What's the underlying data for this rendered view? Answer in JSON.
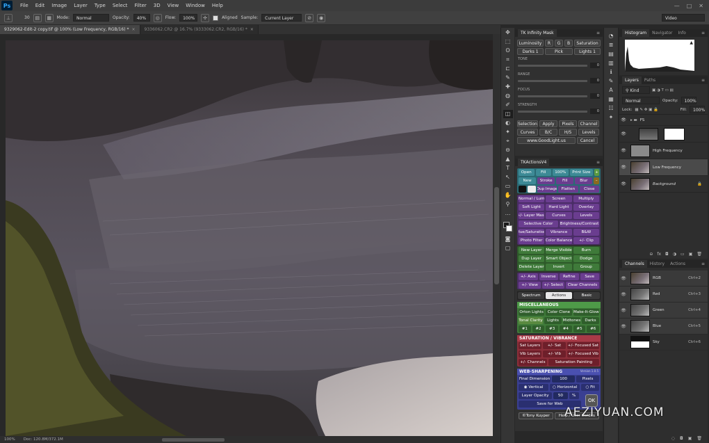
{
  "app": {
    "logo": "Ps"
  },
  "menu": [
    "File",
    "Edit",
    "Image",
    "Layer",
    "Type",
    "Select",
    "Filter",
    "3D",
    "View",
    "Window",
    "Help"
  ],
  "window_controls": [
    "—",
    "□",
    "✕"
  ],
  "options": {
    "size": "30",
    "mode_label": "Mode:",
    "mode_value": "Normal",
    "opacity_label": "Opacity:",
    "opacity_value": "40%",
    "flow_label": "Flow:",
    "flow_value": "100%",
    "aligned_label": "Aligned",
    "sample_label": "Sample:",
    "sample_value": "Current Layer",
    "workspace": "Video"
  },
  "tabs": [
    {
      "label": "9329062-Edit-2 copy.tif @ 100% (Low Frequency, RGB/16) *",
      "close": "×"
    },
    {
      "label": "9336062.CR2 @ 16.7% (9333062.CR2, RGB/16) *",
      "close": "×"
    }
  ],
  "status": {
    "zoom": "100%",
    "doc": "Doc: 120.8M/372.1M"
  },
  "tools": [
    "✥",
    "⬚",
    "ʘ",
    "⌗",
    "⊏",
    "✎",
    "✚",
    "◍",
    "✐",
    "◫",
    "◐",
    "✦",
    "⌖",
    "⊖",
    "▲",
    "T",
    "↖",
    "▭",
    "✋",
    "⚲",
    "…"
  ],
  "tk_mask": {
    "title": "TK Infinity Mask",
    "top_row": [
      "Luminosity",
      "R",
      "G",
      "B",
      "Saturation"
    ],
    "second_row": [
      "Darks 1",
      "Pick",
      "Lights 1"
    ],
    "sliders": [
      {
        "label": "TONE",
        "value": "0"
      },
      {
        "label": "RANGE",
        "value": "0"
      },
      {
        "label": "FOCUS",
        "value": "0"
      },
      {
        "label": "STRENGTH",
        "value": "0"
      }
    ],
    "row_a": [
      "Selection",
      "Apply",
      "Pixels",
      "Channel"
    ],
    "row_b": [
      "Curves",
      "B/C",
      "H/S",
      "Levels"
    ],
    "row_c": [
      "www.GoodLight.us",
      "Cancel"
    ]
  },
  "tk_actions": {
    "title": "TKActionsV4",
    "r1": [
      "Open",
      "Fill",
      "100%",
      "Print Size",
      "+"
    ],
    "r2": [
      "New",
      "Stroke",
      "Fill",
      "Blur",
      "–"
    ],
    "r3": [
      "Dup Image",
      "Flatten",
      "Close"
    ],
    "purple_rows": [
      [
        "Normal / Lum",
        "Screen",
        "Multiply"
      ],
      [
        "Soft Light",
        "Hard Light",
        "Overlay"
      ],
      [
        "+/- Layer Mask",
        "Curves",
        "Levels"
      ],
      [
        "Selective Color",
        "Brightness/Contrast"
      ],
      [
        "Hue/Saturation",
        "Vibrance",
        "B&W"
      ],
      [
        "Photo Filter",
        "Color Balance",
        "+/- Clip"
      ]
    ],
    "green_rows": [
      [
        "New Layer",
        "Merge Visible",
        "Burn"
      ],
      [
        "Dup Layer",
        "Smart Object",
        "Dodge"
      ],
      [
        "Delete Layer",
        "Invert",
        "Group"
      ]
    ],
    "purple_rows_2": [
      [
        "+/- Axis",
        "Inverse",
        "Refine",
        "Save"
      ],
      [
        "+/- View",
        "+/- Select",
        "Clear Channels"
      ]
    ],
    "tabs": [
      "Spectrum",
      "Actions",
      "Basic"
    ],
    "misc": {
      "title": "MISCELLANEOUS",
      "rows": [
        [
          "Orton Lights",
          "Color Clone",
          "Make-It-Glow"
        ],
        [
          "Tonal Clarity",
          "Lights",
          "Midtones",
          "Darks"
        ],
        [
          "#1",
          "#2",
          "#3",
          "#4",
          "#5",
          "#6"
        ]
      ]
    },
    "sat": {
      "title": "SATURATION / VIBRANCE",
      "rows": [
        [
          "Sat Layers",
          "+/- Sat",
          "+/- Focused Sat"
        ],
        [
          "Vib Layers",
          "+/- Vib",
          "+/- Focused Vib"
        ],
        [
          "+/- Channels",
          "Saturation Painting"
        ]
      ]
    },
    "web": {
      "title": "WEB-SHARPENING",
      "version": "Version 1.0.5",
      "final_dim_label": "Final Dimension",
      "final_dim_value": "100",
      "final_dim_unit": "Pixels",
      "orient": [
        "Vertical",
        "Horizontal",
        "Fit"
      ],
      "opacity_label": "Layer Opacity",
      "opacity_value": "50",
      "opacity_unit": "%",
      "save": "Save for Web",
      "ok": "OK"
    },
    "footer": [
      "©Tony Kuyper",
      "Help / User Guides"
    ]
  },
  "histogram": {
    "tabs": [
      "Histogram",
      "Navigator",
      "Info"
    ],
    "warning": "▲"
  },
  "layers": {
    "tabs": [
      "Layers",
      "Paths"
    ],
    "kind_label": "Kind",
    "blend": "Normal",
    "opacity_label": "Opacity:",
    "opacity_value": "100%",
    "lock_label": "Lock:",
    "fill_label": "Fill:",
    "fill_value": "100%",
    "items": [
      {
        "name": "FS",
        "type": "group"
      },
      {
        "name": "",
        "type": "white"
      },
      {
        "name": "High Frequency",
        "type": "gray"
      },
      {
        "name": "Low Frequency",
        "type": "photo",
        "selected": true
      },
      {
        "name": "Background",
        "type": "photo",
        "lock": "🔒"
      }
    ],
    "bottom_icons": [
      "⊖",
      "fx",
      "◘",
      "◑",
      "▭",
      "▣",
      "🗑"
    ]
  },
  "channels": {
    "tabs": [
      "Channels",
      "History",
      "Actions"
    ],
    "items": [
      {
        "name": "RGB",
        "shortcut": "Ctrl+2"
      },
      {
        "name": "Red",
        "shortcut": "Ctrl+3"
      },
      {
        "name": "Green",
        "shortcut": "Ctrl+4"
      },
      {
        "name": "Blue",
        "shortcut": "Ctrl+5"
      },
      {
        "name": "Sky",
        "shortcut": "Ctrl+6"
      }
    ]
  },
  "watermark": "AEZIYUAN.COM",
  "colors": {
    "purple": "#6a3d8f",
    "green": "#3f7a3a",
    "red": "#8c2f3a",
    "blue": "#3a3f92",
    "teal": "#3d7e8a"
  }
}
